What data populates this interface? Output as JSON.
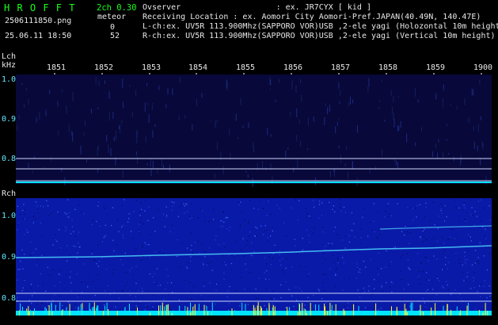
{
  "header": {
    "app_title": "H R O F F T",
    "version": "2ch 0.30",
    "filename": "2506111850.png",
    "meteor_label": "meteor",
    "meteor_lch": "0",
    "meteor_rch": "52",
    "datetime": "25.06.11 18:50",
    "observer": "Ovserver                    : ex. JR7CYX [ kid ]",
    "location": "Receiving Location : ex. Aomori City Aomori-Pref.JAPAN(40.49N, 140.47E)",
    "lch_info": "L-ch:ex. UV5R 113.900Mhz(SAPPORO VOR)USB ,2-ele yagi (Holozontal 10m height",
    "rch_info": "R-ch:ex. UV5R 113.900Mhz(SAPPORO VOR)USB ,2-ele yagi (Vertical 10m height)"
  },
  "time_axis": {
    "ticks": [
      "1851",
      "1852",
      "1853",
      "1854",
      "1855",
      "1856",
      "1857",
      "1858",
      "1859",
      "1900"
    ]
  },
  "lch_panel": {
    "channel_label": "Lch",
    "unit_label": "kHz",
    "freq_ticks": [
      "1.0",
      "0.9",
      "0.8"
    ]
  },
  "rch_panel": {
    "channel_label": "Rch",
    "freq_ticks": [
      "1.0",
      "0.9",
      "0.8"
    ]
  },
  "colors": {
    "title": "#19ff19",
    "freq_label": "#62e7ff",
    "lch_bg": "#08083a",
    "rch_bg": "#0a1aa8",
    "guide_line": "#cfd8ff",
    "signal": "#4fd8ff",
    "base_cyan": "#00e5ff",
    "base_yellow": "#ffff33"
  }
}
